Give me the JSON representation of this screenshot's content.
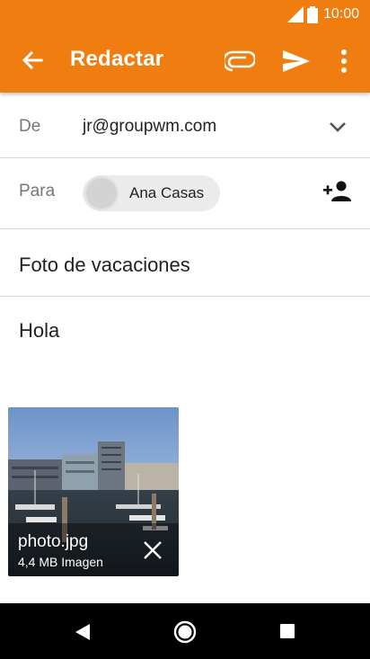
{
  "status_bar": {
    "time": "10:00",
    "signal_icon": "signal-icon",
    "battery_icon": "battery-icon"
  },
  "toolbar": {
    "title": "Redactar",
    "back_icon": "arrow-back-icon",
    "attach_icon": "paperclip-icon",
    "send_icon": "send-icon",
    "more_icon": "more-vert-icon",
    "color": "#ef7d0f"
  },
  "from": {
    "label": "De",
    "value": "jr@groupwm.com",
    "dropdown_icon": "chevron-down-icon"
  },
  "to": {
    "label": "Para",
    "recipient": "Ana Casas",
    "add_icon": "add-person-icon"
  },
  "subject": {
    "value": "Foto de vacaciones"
  },
  "body": {
    "text": "Hola"
  },
  "attachment": {
    "filename": "photo.jpg",
    "meta": "4,4 MB Imagen",
    "remove_icon": "close-icon"
  },
  "nav_bar": {
    "back_icon": "nav-back-icon",
    "home_icon": "nav-home-icon",
    "recents_icon": "nav-recents-icon"
  }
}
